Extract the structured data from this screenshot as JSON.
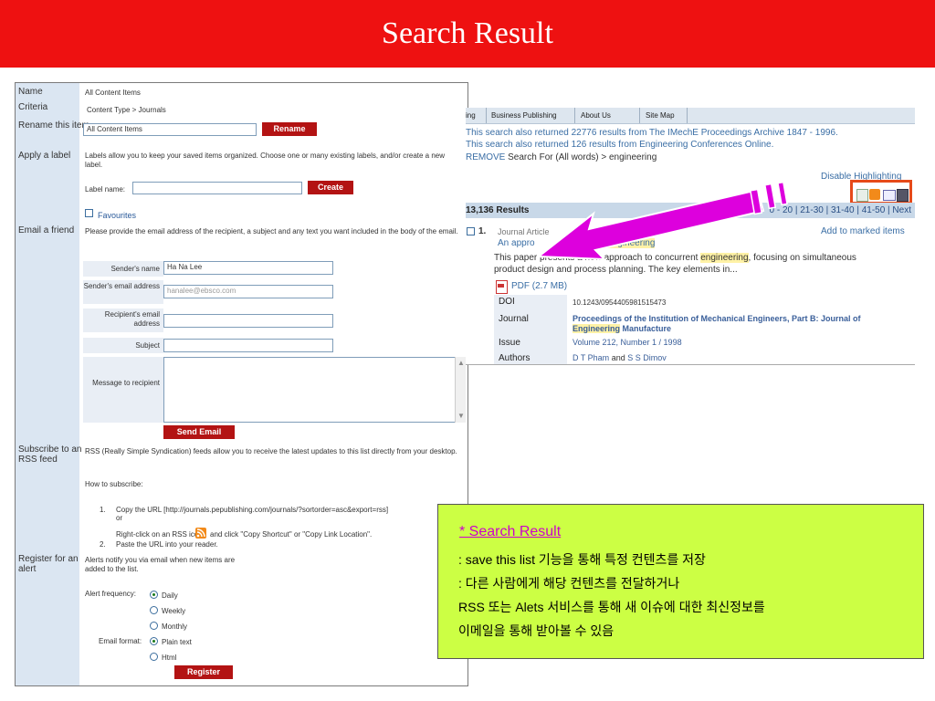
{
  "slide": {
    "title": "Search Result"
  },
  "form": {
    "criteria_rows": [
      {
        "label": "Name",
        "value": "All Content Items"
      },
      {
        "label": "Criteria",
        "value": "Content Type > Journals"
      }
    ],
    "rename": {
      "label": "Rename this item",
      "input_value": "All Content Items",
      "button": "Rename"
    },
    "apply_label": {
      "label": "Apply a label",
      "description": "Labels allow you to keep your saved items organized. Choose one or many existing labels, and/or create a new label.",
      "field_label": "Label name:",
      "button": "Create",
      "favourites": "Favourites"
    },
    "email": {
      "label": "Email a friend",
      "description": "Please provide the email address of the recipient, a subject and any text you want included in the body of the email.",
      "sender_name_label": "Sender's name",
      "sender_name_value": "Ha Na Lee",
      "sender_email_label": "Sender's email address",
      "sender_email_value": "hanalee@ebsco.com",
      "recipient_label": "Recipient's email address",
      "subject_label": "Subject",
      "message_label": "Message to recipient",
      "button": "Send Email"
    },
    "rss": {
      "label": "Subscribe to an RSS feed",
      "description": "RSS (Really Simple Syndication) feeds allow you to receive the latest updates to this list directly from your desktop.",
      "how_to": "How to subscribe:",
      "step1": "Copy the URL [http://journals.pepublishing.com/journals/?sortorder=asc&export=rss]",
      "or": "or",
      "step1b_pre": "Right-click on an RSS icon",
      "step1b_post": "and click \"Copy Shortcut\" or \"Copy Link Location\".",
      "step2": "Paste the URL into your reader.",
      "num1": "1.",
      "num2": "2."
    },
    "alert": {
      "label": "Register for an alert",
      "description": "Alerts notify you via email when new items are added to the list.",
      "frequency_label": "Alert frequency:",
      "frequencies": [
        "Daily",
        "Weekly",
        "Monthly"
      ],
      "format_label": "Email format:",
      "formats": [
        "Plain text",
        "Html"
      ],
      "button": "Register"
    }
  },
  "results": {
    "nav": [
      "ing",
      "Business Publishing",
      "About Us",
      "Site Map"
    ],
    "notice1": "This search also returned 22776 results from The IMechE Proceedings Archive 1847 - 1996.",
    "notice2": "This search also returned 126 results from Engineering Conferences Online.",
    "remove_link": "REMOVE",
    "remove_text": "Search For (All words) > engineering",
    "disable_highlighting": "Disable Highlighting",
    "count": "13,136 Results",
    "pagination": "0 - 20 | 21-30 | 31-40 | 41-50 | Next",
    "item": {
      "number": "1.",
      "type": "Journal Article",
      "title_prefix": "An appro",
      "title_highlight": "engineering",
      "add_marked": "Add to marked items",
      "abstract_pre": "This paper presents a new approach to concurrent",
      "abstract_hl": "engineering",
      "abstract_post": ", focusing on simultaneous",
      "abstract_line2": "product design and process planning. The key elements in...",
      "pdf": "PDF (2.7 MB)",
      "meta_labels": [
        "DOI",
        "Journal",
        "Issue",
        "Authors"
      ],
      "doi": "10.1243/0954405981515473",
      "journal_line1": "Proceedings of the Institution of Mechanical Engineers, Part B: Journal of",
      "journal_hl": "Engineering",
      "journal_line2_post": "Manufacture",
      "issue": "Volume 212, Number 1 / 1998",
      "authors_a": "D T Pham",
      "authors_and": "and",
      "authors_b": "S S Dimov"
    }
  },
  "callout": {
    "title": "* Search Result",
    "lines": [
      ": save this list 기능을 통해 특정 컨텐츠를 저장",
      ": 다른 사람에게 해당 컨텐츠를 전달하거나",
      "  RSS 또는 Alets 서비스를 통해 새 이슈에 대한 최신정보를",
      "  이메일을 통해 받아볼 수 있음"
    ]
  },
  "colors": {
    "title_bar": "#ee1111",
    "button": "#b31313",
    "callout_bg": "#ccff44",
    "callout_title": "#cc00cc",
    "arrow": "#dd00dd",
    "highlight": "#fff2a6"
  }
}
